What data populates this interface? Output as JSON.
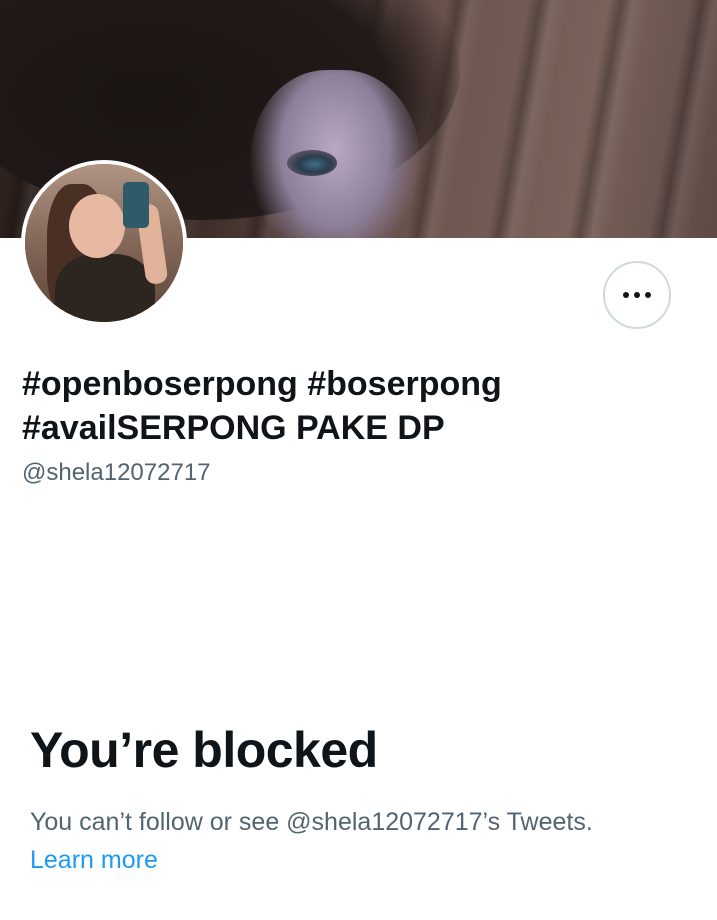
{
  "profile": {
    "display_name_line1": "#openboserpong #boserpong",
    "display_name_line2": "#availSERPONG PAKE DP",
    "handle": "@shela12072717"
  },
  "actions": {
    "more_icon": "more-horizontal-icon"
  },
  "blocked": {
    "title": "You’re blocked",
    "description": "You can’t follow or see @shela12072717’s Tweets.",
    "learn_more": "Learn more"
  },
  "colors": {
    "text_primary": "#0f1419",
    "text_secondary": "#536471",
    "link": "#1d9bf0",
    "border": "#cfd9de"
  }
}
